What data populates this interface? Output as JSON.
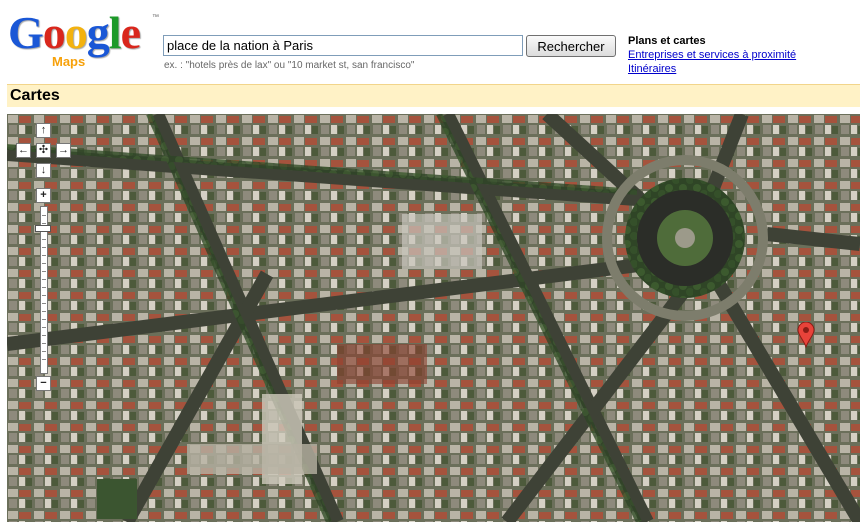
{
  "logo": {
    "word": [
      "G",
      "o",
      "o",
      "g",
      "l",
      "e"
    ],
    "colors": [
      "#1a57d6",
      "#d9271c",
      "#f3b20f",
      "#1a57d6",
      "#1d9a2a",
      "#d9271c"
    ],
    "tm": "™",
    "sub": "Maps"
  },
  "search": {
    "value": "place de la nation à Paris",
    "button_label": "Rechercher",
    "example": "ex. : \"hotels près de lax\" ou \"10 market st, san francisco\""
  },
  "side": {
    "title": "Plans et cartes",
    "links": [
      "Entreprises et services à proximité",
      "Itinéraires"
    ]
  },
  "section": {
    "title": "Cartes"
  },
  "map_controls": {
    "pan_up": "↑",
    "pan_left": "←",
    "pan_center": "✣",
    "pan_right": "→",
    "pan_down": "↓",
    "zoom_in": "+",
    "zoom_out": "−"
  },
  "colors": {
    "accent_bar": "#fff2c6",
    "link": "#0000cc",
    "marker": "#e8433a"
  }
}
